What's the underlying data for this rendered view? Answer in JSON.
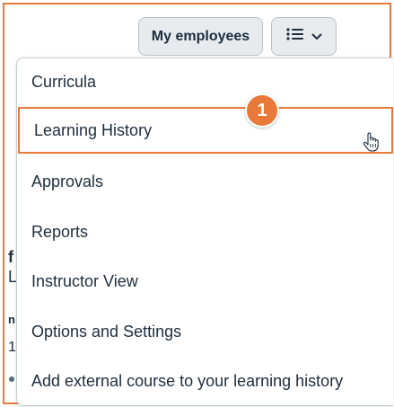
{
  "toolbar": {
    "employees_label": "My employees",
    "menu_icon": "list-icon",
    "chevron_icon": "chevron-down-icon"
  },
  "menu": {
    "items": [
      {
        "label": "Curricula"
      },
      {
        "label": "Learning History"
      },
      {
        "label": "Approvals"
      },
      {
        "label": "Reports"
      },
      {
        "label": "Instructor View"
      },
      {
        "label": "Options and Settings"
      },
      {
        "label": "Add external course to your learning history"
      }
    ]
  },
  "callout": {
    "number": "1"
  },
  "background_fragments": [
    "f",
    "L",
    "n",
    "1"
  ],
  "colors": {
    "accent": "#e8793a",
    "text": "#1d2d3e",
    "button_bg": "#e8ebee"
  }
}
